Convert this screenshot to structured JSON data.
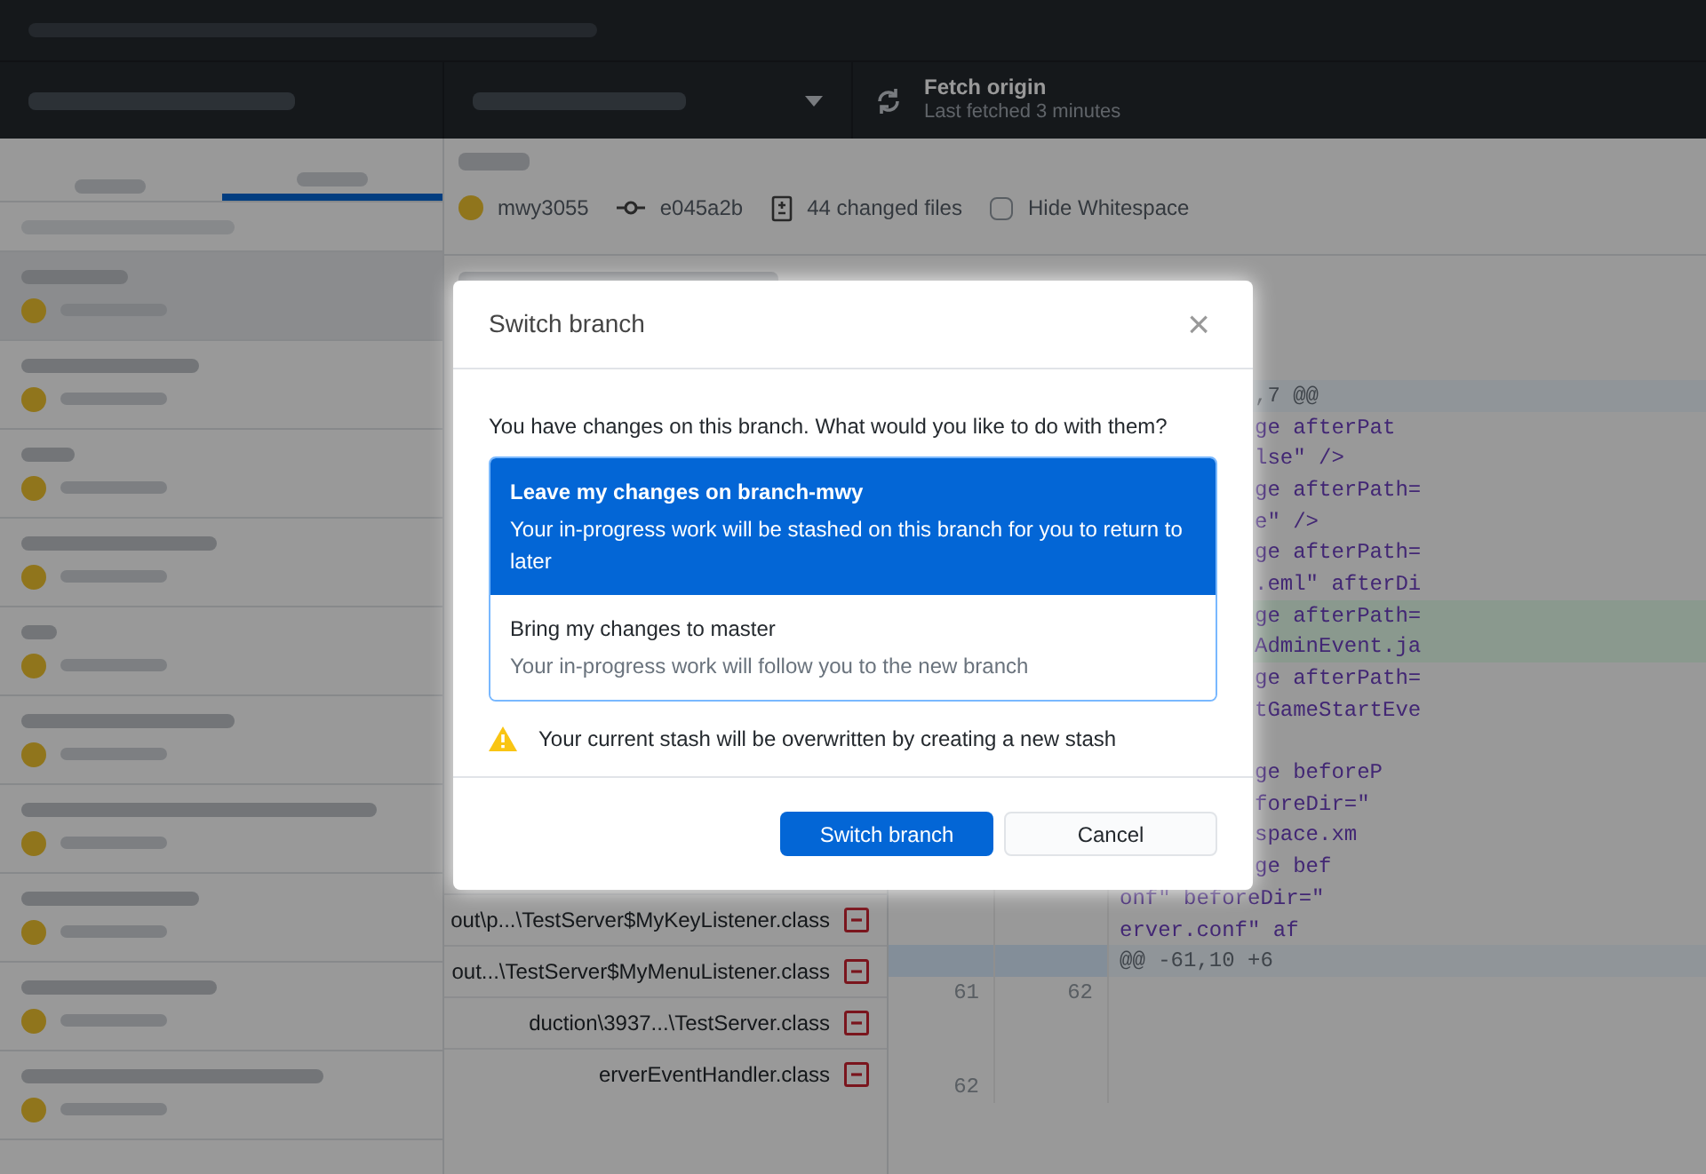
{
  "toolbar": {
    "fetch": {
      "title": "Fetch origin",
      "subtitle": "Last fetched 3 minutes"
    }
  },
  "commit": {
    "author": "mwy3055",
    "sha": "e045a2b",
    "changed_files": "44 changed files",
    "hide_whitespace": {
      "label": "Hide Whitespace",
      "checked": false
    }
  },
  "files": [
    {
      "path": "out\\p...\\TestServer$MyKeyListener.class",
      "kind": "removed"
    },
    {
      "path": "out...\\TestServer$MyMenuListener.class",
      "kind": "removed"
    },
    {
      "path": "duction\\3937...\\TestServer.class",
      "kind": "removed"
    },
    {
      "path": "erverEventHandler.class",
      "kind": "removed"
    }
  ],
  "diff": [
    {
      "kind": "hunk",
      "text": ",7 @@"
    },
    {
      "kind": "context",
      "text": "ge afterPat"
    },
    {
      "kind": "context",
      "text": "lse\" />"
    },
    {
      "kind": "context",
      "text": "ge afterPath="
    },
    {
      "kind": "context",
      "text": "e\" />"
    },
    {
      "kind": "context",
      "text": "ge afterPath="
    },
    {
      "kind": "context",
      "text": ".eml\" afterDi"
    },
    {
      "kind": "added",
      "text": "ge afterPath="
    },
    {
      "kind": "added",
      "text": "AdminEvent.ja"
    },
    {
      "kind": "context",
      "text": "ge afterPath="
    },
    {
      "kind": "context",
      "text": "tGameStartEve"
    },
    {
      "kind": "context"
    },
    {
      "kind": "context",
      "text": "ge beforeP"
    },
    {
      "kind": "context",
      "text": "foreDir=\""
    },
    {
      "kind": "context",
      "text": "space.xm"
    },
    {
      "kind": "context",
      "text": "ge bef"
    },
    {
      "kind": "context",
      "text": "onf\" beforeDir=\""
    },
    {
      "kind": "context",
      "text": "erver.conf\" af"
    },
    {
      "kind": "hunk",
      "text": "@@ -61,10 +6"
    },
    {
      "kind": "context",
      "old_no": "61",
      "new_no": "62"
    },
    {
      "kind": "context"
    },
    {
      "kind": "context"
    },
    {
      "kind": "context",
      "old_no": "62"
    }
  ],
  "dialog": {
    "title": "Switch branch",
    "close": "×",
    "prompt": "You have changes on this branch. What would you like to do with them?",
    "options": [
      {
        "title": "Leave my changes on branch-mwy",
        "description": "Your in-progress work will be stashed on this branch for you to return to later",
        "selected": true
      },
      {
        "title": "Bring my changes to master",
        "description": "Your in-progress work will follow you to the new branch",
        "selected": false
      }
    ],
    "warning": "Your current stash will be overwritten by creating a new stash",
    "buttons": {
      "primary": "Switch branch",
      "secondary": "Cancel"
    }
  }
}
